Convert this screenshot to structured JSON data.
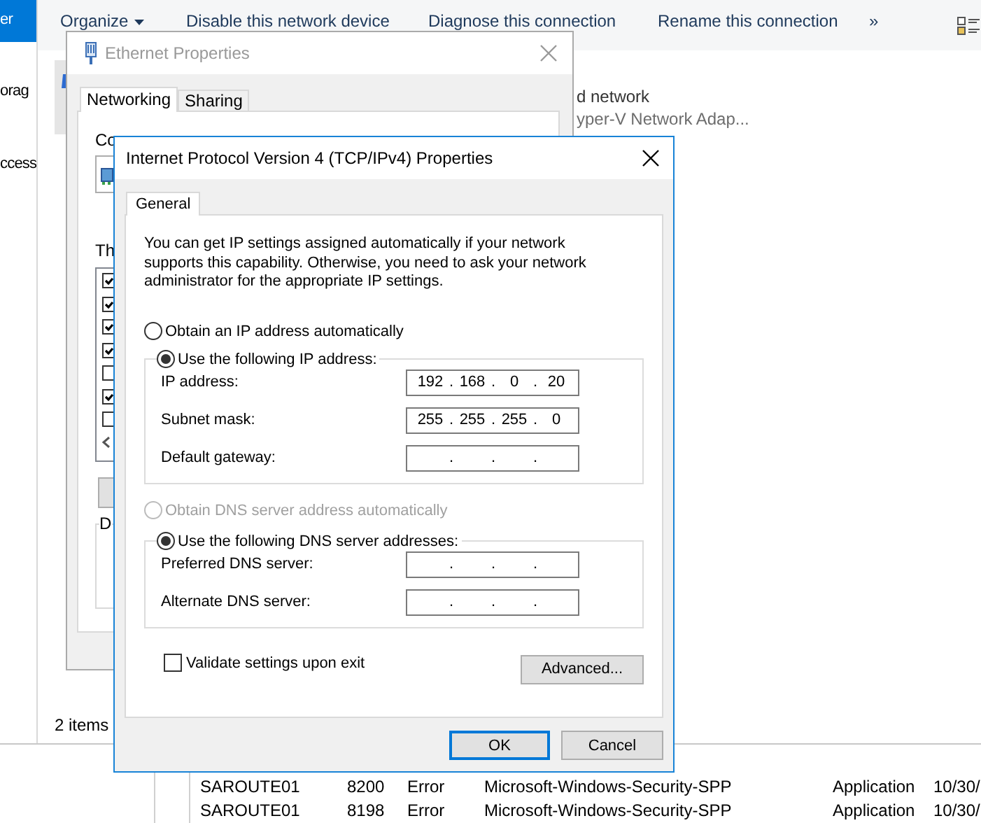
{
  "explorer": {
    "nav_items": [
      {
        "label": "er",
        "selected": true
      },
      {
        "label": "orag",
        "selected": false
      },
      {
        "label": "ccess",
        "selected": false
      }
    ],
    "toolbar": [
      {
        "label": "Organize",
        "kind": "menu"
      },
      {
        "label": "Disable this network device",
        "kind": "command"
      },
      {
        "label": "Diagnose this connection",
        "kind": "command"
      },
      {
        "label": "Rename this connection",
        "kind": "command"
      },
      {
        "label": "»",
        "kind": "overflow"
      }
    ],
    "connection": {
      "line_1": "d network",
      "line_2": "yper-V Network Adap...",
      "selected": true
    },
    "status_bar": "2 items"
  },
  "event_log": {
    "rows": [
      {
        "cells": [
          "SAROUTE01",
          "8200",
          "Error",
          "Microsoft-Windows-Security-SPP",
          "Application",
          "10/30/"
        ]
      },
      {
        "cells": [
          "SAROUTE01",
          "8198",
          "Error",
          "Microsoft-Windows-Security-SPP",
          "Application",
          "10/30/"
        ]
      }
    ]
  },
  "ethernet_properties": {
    "title": "Ethernet Properties",
    "active": false,
    "tabs": [
      {
        "label": "Networking",
        "selected": true
      },
      {
        "label": "Sharing",
        "selected": false
      }
    ],
    "connect_label": "Co",
    "components_label": "Th",
    "components": [
      {
        "checked": true
      },
      {
        "checked": true
      },
      {
        "checked": true
      },
      {
        "checked": true
      },
      {
        "checked": false
      },
      {
        "checked": true
      },
      {
        "checked": false
      }
    ],
    "group_label": "D"
  },
  "ipv4_properties": {
    "title": "Internet Protocol Version 4 (TCP/IPv4) Properties",
    "active": true,
    "tabs": [
      {
        "label": "General",
        "selected": true
      }
    ],
    "description": "You can get IP settings assigned automatically if your network supports this capability. Otherwise, you need to ask your network administrator for the appropriate IP settings.",
    "ip_options": [
      {
        "label": "Obtain an IP address automatically",
        "selected": false,
        "disabled": false
      },
      {
        "label": "Use the following IP address:",
        "selected": true,
        "disabled": false
      }
    ],
    "ip_fields": [
      {
        "label": "IP address:",
        "octets": [
          "192",
          "168",
          "0",
          "20"
        ],
        "dots": [
          ".",
          ".",
          "."
        ]
      },
      {
        "label": "Subnet mask:",
        "octets": [
          "255",
          "255",
          "255",
          "0"
        ],
        "dots": [
          ".",
          ".",
          "."
        ]
      },
      {
        "label": "Default gateway:",
        "dots": [
          ".",
          ".",
          "."
        ]
      }
    ],
    "dns_options": [
      {
        "label": "Obtain DNS server address automatically",
        "selected": false,
        "disabled": true
      },
      {
        "label": "Use the following DNS server addresses:",
        "selected": true,
        "disabled": false
      }
    ],
    "dns_fields": [
      {
        "label": "Preferred DNS server:",
        "dots": [
          ".",
          ".",
          "."
        ]
      },
      {
        "label": "Alternate DNS server:",
        "dots": [
          ".",
          ".",
          "."
        ]
      }
    ],
    "validate": {
      "label": "Validate settings upon exit",
      "checked": false
    },
    "advanced_button": "Advanced...",
    "buttons": [
      {
        "label": "OK",
        "kind": "default"
      },
      {
        "label": "Cancel",
        "kind": "normal"
      }
    ]
  }
}
